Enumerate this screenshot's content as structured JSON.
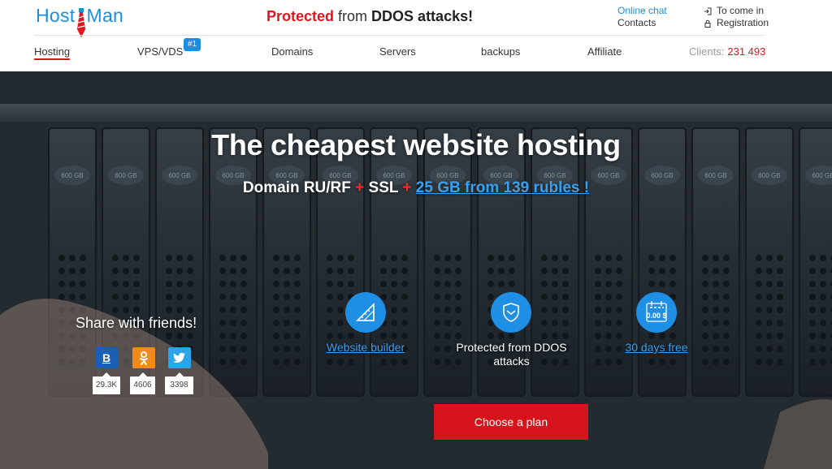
{
  "header": {
    "logo_left": "Host",
    "logo_right": "Man",
    "tagline": {
      "highlight": "Protected",
      "middle": " from ",
      "bold": "DDOS attacks!"
    },
    "support": {
      "chat": "Online chat",
      "contacts": "Contacts"
    },
    "auth": {
      "login": "To come in",
      "register": "Registration"
    },
    "nav": [
      {
        "label": "Hosting"
      },
      {
        "label": "VPS/VDS"
      },
      {
        "label": "Domains"
      },
      {
        "label": "Servers"
      },
      {
        "label": "backups"
      },
      {
        "label": "Affiliate"
      }
    ],
    "badge": "#1",
    "clients_label": "Clients:",
    "clients_count": "231 493"
  },
  "hero": {
    "title": "The cheapest website hosting",
    "subtitle": {
      "part1": "Domain RU/RF",
      "plus1": " + ",
      "part2": "SSL",
      "plus2": " + ",
      "price": "25 GB from 139 rubles",
      "end": " !"
    },
    "drive_label": "600 GB"
  },
  "share": {
    "title": "Share with friends!",
    "buttons": [
      {
        "icon": "vk-icon",
        "glyph": "В",
        "count": "29.3K",
        "color": "#1a5fb4"
      },
      {
        "icon": "odnoklassniki-icon",
        "glyph": "ок",
        "count": "4606",
        "color": "#f08a1c"
      },
      {
        "icon": "twitter-icon",
        "glyph": "t",
        "count": "3398",
        "color": "#2aa5e8"
      }
    ]
  },
  "features": [
    {
      "icon": "ruler-triangle-icon",
      "label": "Website builder"
    },
    {
      "icon": "shield-icon",
      "label": "Protected from DDOS attacks"
    },
    {
      "icon": "calendar-icon",
      "label": "30 days free",
      "icon_text": "0.00 $"
    }
  ],
  "cta": {
    "label": "Choose a plan"
  },
  "colors": {
    "brand_blue": "#1b8ee0",
    "accent_red": "#e0161e",
    "feature_blue": "#1f8fe6"
  }
}
